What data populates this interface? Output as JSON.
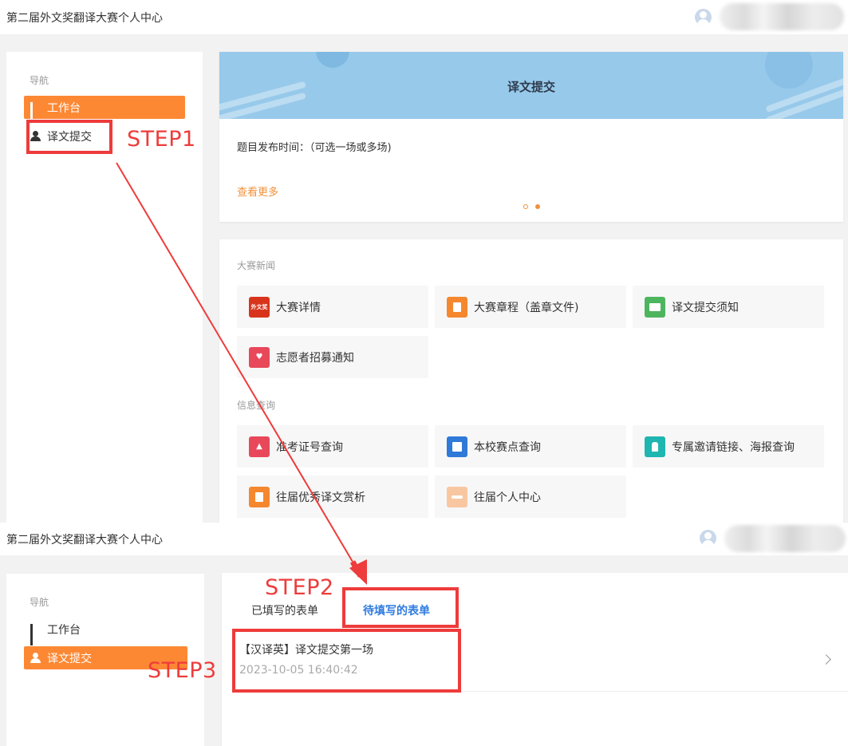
{
  "app_title": "第二届外文奖翻译大赛个人中心",
  "nav": {
    "heading": "导航",
    "items": [
      {
        "label": "工作台"
      },
      {
        "label": "译文提交"
      }
    ]
  },
  "banner": {
    "title": "译文提交",
    "info": "题目发布时间：（可选一场或多场)",
    "more": "查看更多"
  },
  "news": {
    "heading": "大赛新闻",
    "tiles": [
      {
        "label": "大赛详情",
        "color": "#e0391e",
        "icon": "外文奖"
      },
      {
        "label": "大赛章程（盖章文件)",
        "color": "#f5872f",
        "icon": ""
      },
      {
        "label": "译文提交须知",
        "color": "#4db55e",
        "icon": ""
      },
      {
        "label": "志愿者招募通知",
        "color": "#e8485a",
        "icon": ""
      }
    ]
  },
  "query": {
    "heading": "信息查询",
    "tiles": [
      {
        "label": "准考证号查询",
        "color": "#e8485a"
      },
      {
        "label": "本校赛点查询",
        "color": "#2f79d9"
      },
      {
        "label": "专属邀请链接、海报查询",
        "color": "#1fb5b0"
      },
      {
        "label": "往届优秀译文赏析",
        "color": "#f5872f"
      },
      {
        "label": "往届个人中心",
        "color": "#f8c7a2"
      }
    ]
  },
  "tabs": {
    "filled": "已填写的表单",
    "pending": "待填写的表单"
  },
  "form_item": {
    "title": "【汉译英】译文提交第一场",
    "time": "2023-10-05 16:40:42"
  },
  "steps": {
    "step1": "STEP1",
    "step2": "STEP2",
    "step3": "STEP3"
  },
  "colors": {
    "accent": "#fd8834",
    "annotation": "#ee3b3b",
    "tab_active": "#2f7be0"
  }
}
